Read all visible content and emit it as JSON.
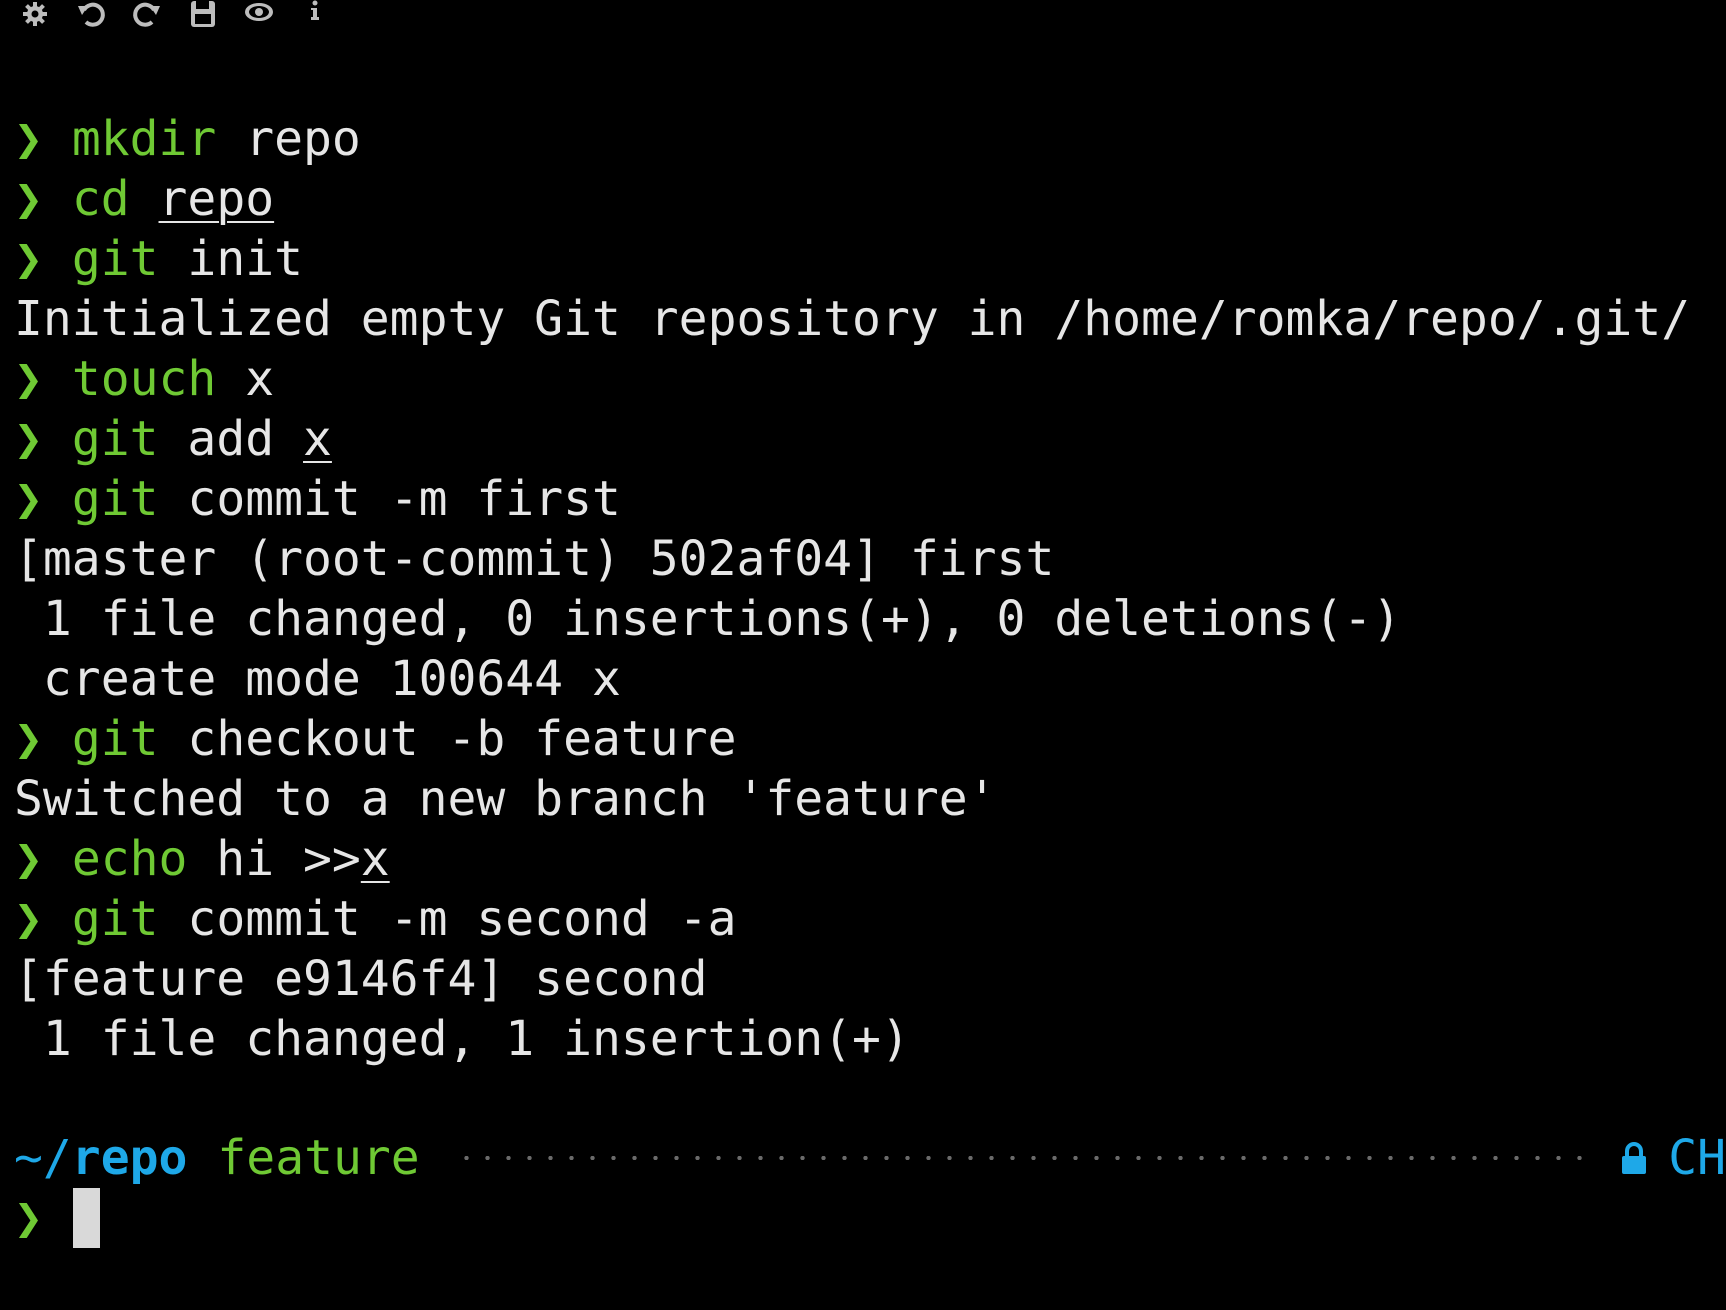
{
  "toolbar": {
    "icons": [
      "gear-icon",
      "undo-icon",
      "redo-icon",
      "save-icon",
      "eye-icon",
      "info-icon"
    ]
  },
  "prompt_symbol": "❯",
  "terminal": {
    "lines": [
      {
        "type": "cmd",
        "cmd": "mkdir",
        "args": " repo",
        "underline": ""
      },
      {
        "type": "cmd",
        "cmd": "cd",
        "args": " ",
        "underline": "repo"
      },
      {
        "type": "cmd",
        "cmd": "git",
        "args": " init",
        "underline": ""
      },
      {
        "type": "out",
        "text": "Initialized empty Git repository in /home/romka/repo/.git/"
      },
      {
        "type": "cmd",
        "cmd": "touch",
        "args": " x",
        "underline": ""
      },
      {
        "type": "cmd",
        "cmd": "git",
        "args": " add ",
        "underline": "x"
      },
      {
        "type": "cmd",
        "cmd": "git",
        "args": " commit -m first",
        "underline": ""
      },
      {
        "type": "out",
        "text": "[master (root-commit) 502af04] first"
      },
      {
        "type": "out",
        "text": " 1 file changed, 0 insertions(+), 0 deletions(-)"
      },
      {
        "type": "out",
        "text": " create mode 100644 x"
      },
      {
        "type": "cmd",
        "cmd": "git",
        "args": " checkout -b feature",
        "underline": ""
      },
      {
        "type": "out",
        "text": "Switched to a new branch 'feature'"
      },
      {
        "type": "cmd",
        "cmd": "echo",
        "args": " hi >>",
        "underline": "x"
      },
      {
        "type": "cmd",
        "cmd": "git",
        "args": " commit -m second -a",
        "underline": ""
      },
      {
        "type": "out",
        "text": "[feature e9146f4] second"
      },
      {
        "type": "out",
        "text": " 1 file changed, 1 insertion(+)"
      }
    ]
  },
  "status": {
    "path_prefix": "~/",
    "path_dir": "repo",
    "branch": "feature",
    "lang": "CH",
    "lock_icon": "lock-icon"
  },
  "colors": {
    "background": "#000000",
    "prompt_green": "#6fc934",
    "text": "#e6e6e6",
    "path_blue": "#1ea8e8",
    "dots_gray": "#6b6b6b",
    "cursor": "#d9d9d9"
  }
}
